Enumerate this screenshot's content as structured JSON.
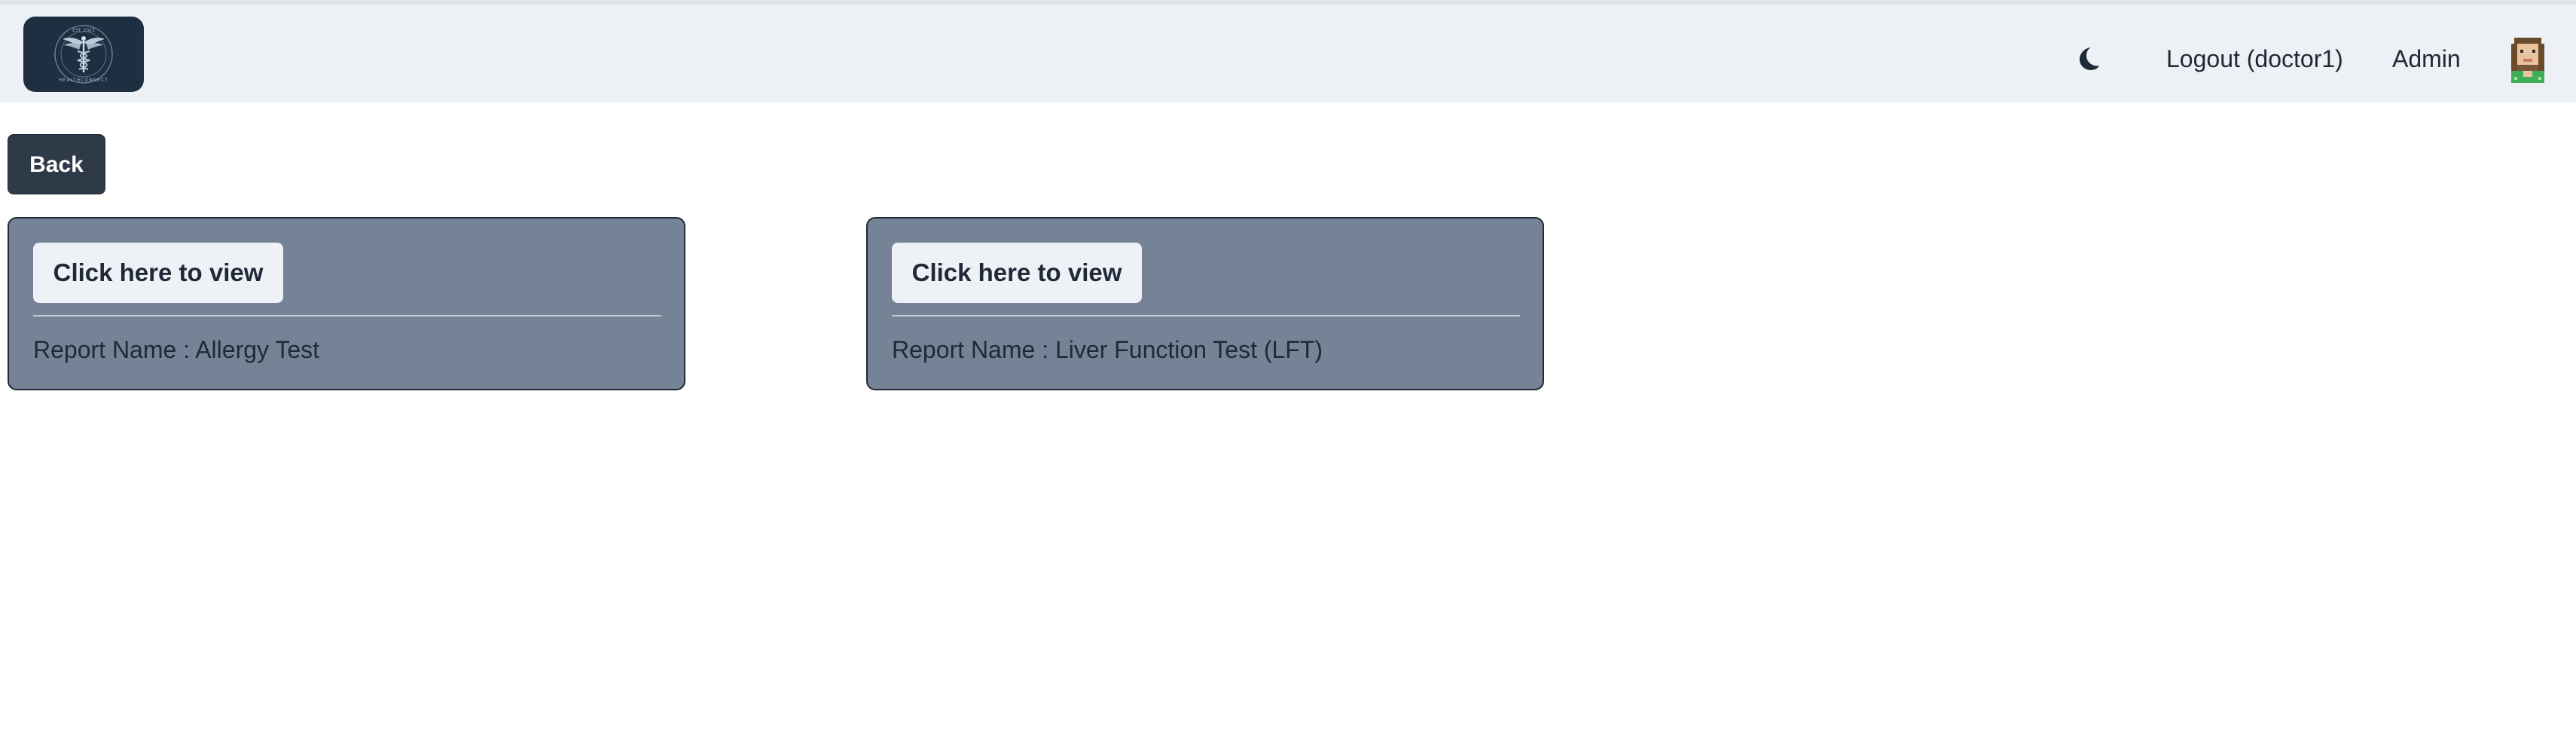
{
  "header": {
    "logo_icon": "healthconnect-caduceus-logo",
    "logo_text": "HEALTHCONNECT",
    "logo_est": "EST. 2023",
    "theme_icon": "moon-icon",
    "logout_label": "Logout (doctor1)",
    "admin_label": "Admin",
    "avatar_icon": "pixel-avatar"
  },
  "back_label": "Back",
  "reports": [
    {
      "view_label": "Click here to view",
      "name_text": "Report Name : Allergy Test"
    },
    {
      "view_label": "Click here to view",
      "name_text": "Report Name : Liver Function Test (LFT)"
    }
  ],
  "colors": {
    "navbar_bg": "#edf0f4",
    "card_bg": "#768296",
    "back_button_bg": "#2f3a48",
    "logo_bg": "#1d2f40"
  }
}
